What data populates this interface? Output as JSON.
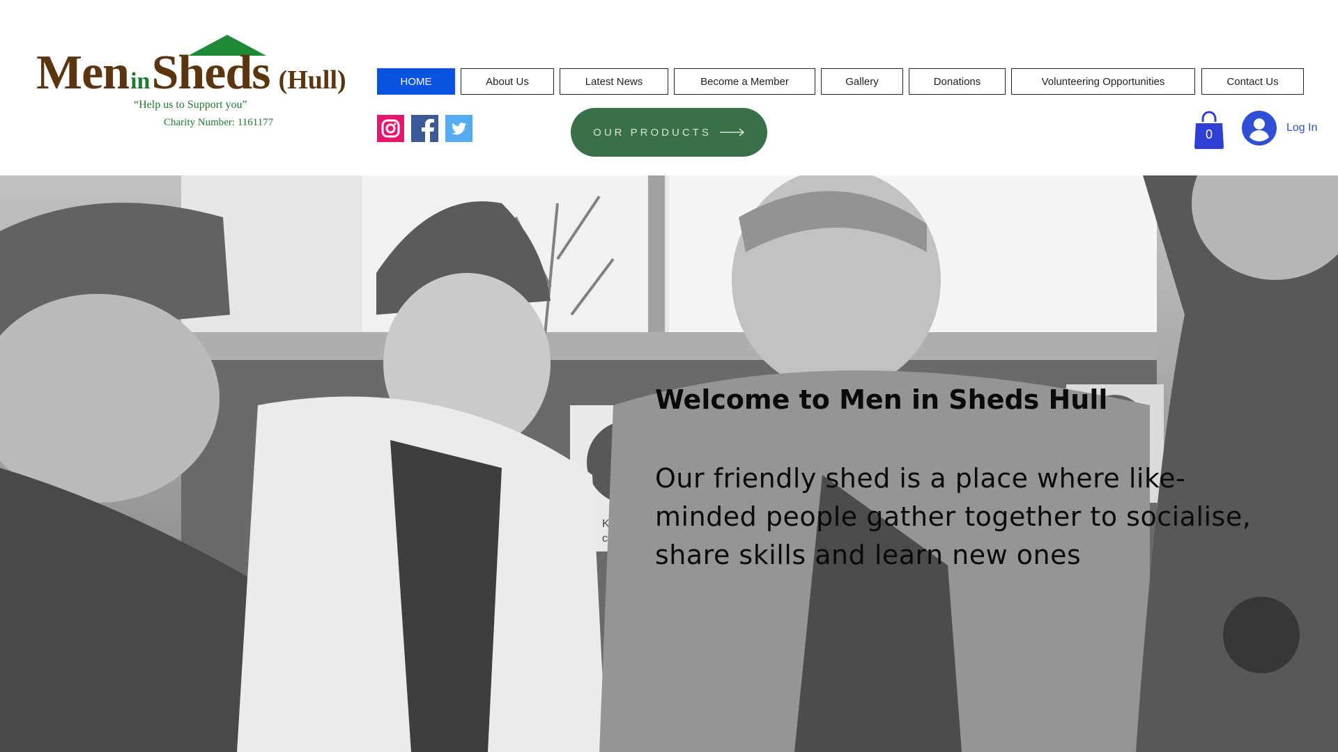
{
  "logo": {
    "word_men": "Men",
    "word_in": "in",
    "word_sheds": "Sheds",
    "word_location": "(Hull)",
    "tagline": "“Help us to Support you”",
    "charity": "Charity Number: 1161177"
  },
  "nav": {
    "items": [
      {
        "label": "HOME",
        "active": true
      },
      {
        "label": "About Us"
      },
      {
        "label": "Latest News"
      },
      {
        "label": "Become a Member"
      },
      {
        "label": "Gallery"
      },
      {
        "label": "Donations"
      },
      {
        "label": "Volunteering Opportunities"
      },
      {
        "label": "Contact Us"
      }
    ]
  },
  "social": [
    {
      "icon": "instagram-icon",
      "color": "#e6166c"
    },
    {
      "icon": "facebook-icon",
      "color": "#3b5998"
    },
    {
      "icon": "twitter-icon",
      "color": "#55acee"
    }
  ],
  "products_button": {
    "label": "OUR PRODUCTS",
    "icon": "arrow-right-icon",
    "color": "#3a7048"
  },
  "cart": {
    "count": "0",
    "icon": "shopping-bag-icon",
    "color": "#2f3fd6"
  },
  "login": {
    "label": "Log In",
    "icon": "user-avatar-icon",
    "color": "#2f4fd6"
  },
  "hero": {
    "title": "Welcome to Men in Sheds Hull",
    "body": "Our friendly shed is a place where like-minded people gather together to socialise, share skills and learn new ones",
    "sign_text": "Keep floo\nclear at a\ntimes"
  },
  "colors": {
    "active_nav": "#0a53e0",
    "brand_green": "#1f7a2e",
    "brand_brown": "#5a3510"
  }
}
